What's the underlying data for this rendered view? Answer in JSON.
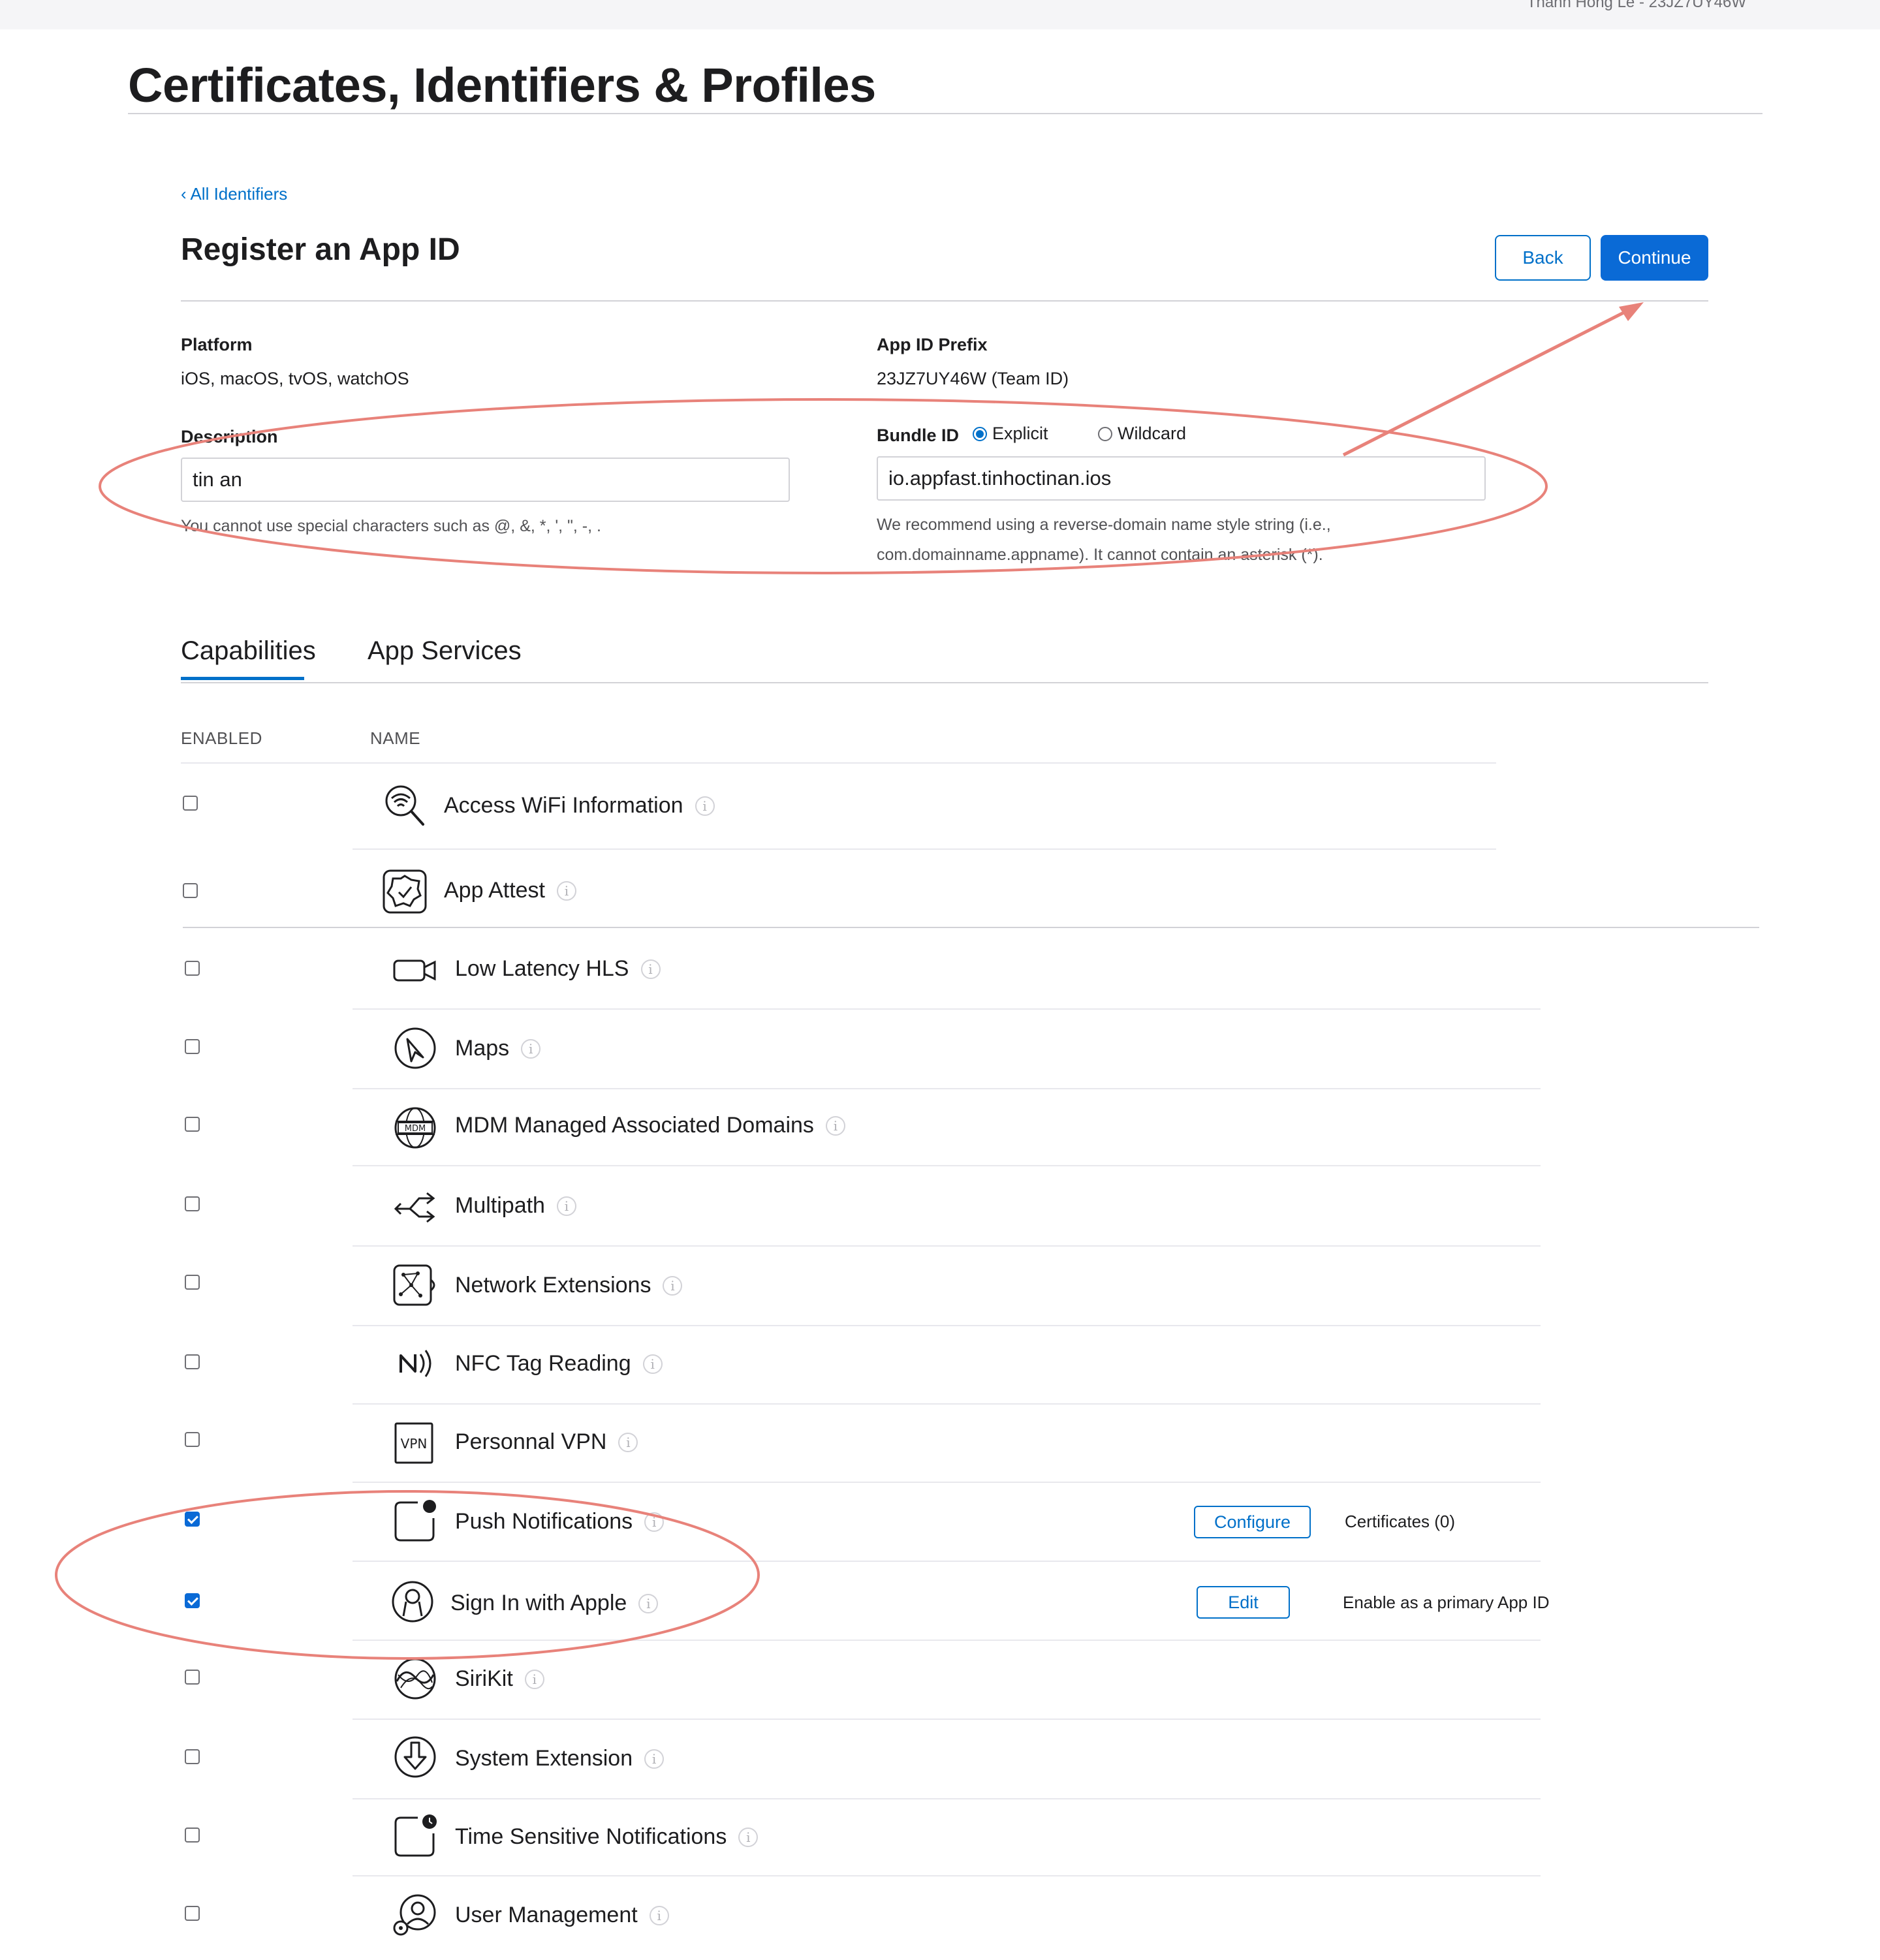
{
  "header": {
    "team_name": "Thanh Hong Le - 23JZ7UY46W"
  },
  "page_title": "Certificates, Identifiers & Profiles",
  "breadcrumb": "‹ All Identifiers",
  "form_title": "Register an App ID",
  "buttons": {
    "back": "Back",
    "continue": "Continue"
  },
  "platform": {
    "label": "Platform",
    "value": "iOS, macOS, tvOS, watchOS"
  },
  "prefix": {
    "label": "App ID Prefix",
    "value": "23JZ7UY46W (Team ID)"
  },
  "description": {
    "label": "Description",
    "value": "tin an",
    "hint": "You cannot use special characters such as @, &, *, ', \", -, ."
  },
  "bundle": {
    "label": "Bundle ID",
    "explicit_label": "Explicit",
    "wildcard_label": "Wildcard",
    "selected": "Explicit",
    "value": "io.appfast.tinhoctinan.ios",
    "hint_line1": "We recommend using a reverse-domain name style string (i.e.,",
    "hint_line2": "com.domainname.appname). It cannot contain an asterisk (*)."
  },
  "tabs": [
    {
      "label": "Capabilities",
      "active": true
    },
    {
      "label": "App Services",
      "active": false
    }
  ],
  "columns": {
    "enabled": "ENABLED",
    "name": "NAME"
  },
  "capabilities": [
    {
      "name": "Access WiFi Information",
      "enabled": false,
      "icon": "wifi-search-icon"
    },
    {
      "name": "App Attest",
      "enabled": false,
      "icon": "app-attest-badge-icon"
    },
    {
      "name": "Low Latency HLS",
      "enabled": false,
      "icon": "video-camera-icon"
    },
    {
      "name": "Maps",
      "enabled": false,
      "icon": "compass-icon"
    },
    {
      "name": "MDM Managed Associated Domains",
      "enabled": false,
      "icon": "mdm-globe-icon"
    },
    {
      "name": "Multipath",
      "enabled": false,
      "icon": "multipath-arrows-icon"
    },
    {
      "name": "Network Extensions",
      "enabled": false,
      "icon": "network-extension-icon"
    },
    {
      "name": "NFC Tag Reading",
      "enabled": false,
      "icon": "nfc-icon"
    },
    {
      "name": "Personnal VPN",
      "enabled": false,
      "icon": "vpn-icon"
    },
    {
      "name": "Push Notifications",
      "enabled": true,
      "icon": "push-notification-icon",
      "action": "Configure",
      "extra": "Certificates (0)"
    },
    {
      "name": "Sign In with Apple",
      "enabled": true,
      "icon": "sign-in-with-apple-icon",
      "action": "Edit",
      "extra": "Enable as a primary App ID"
    },
    {
      "name": "SiriKit",
      "enabled": false,
      "icon": "siri-icon"
    },
    {
      "name": "System Extension",
      "enabled": false,
      "icon": "system-extension-icon"
    },
    {
      "name": "Time Sensitive Notifications",
      "enabled": false,
      "icon": "time-sensitive-icon"
    },
    {
      "name": "User Management",
      "enabled": false,
      "icon": "user-management-icon"
    }
  ],
  "colors": {
    "accent": "#0070c9",
    "annotation": "#e8827a",
    "button_primary": "#0a6ad6"
  }
}
